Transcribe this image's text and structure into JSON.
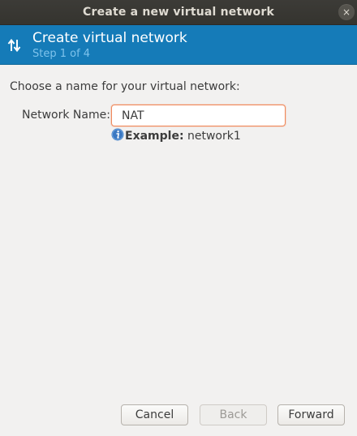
{
  "window": {
    "title": "Create a new virtual network",
    "close_glyph": "×"
  },
  "banner": {
    "icon": "network-arrows-icon",
    "title": "Create virtual network",
    "step": "Step 1 of 4"
  },
  "form": {
    "prompt": "Choose a name for your virtual network:",
    "name_label": "Network Name:",
    "name_value": "NAT",
    "hint_icon": "info-icon",
    "hint_label": "Example:",
    "hint_value": " network1"
  },
  "buttons": {
    "cancel": "Cancel",
    "back": "Back",
    "forward": "Forward"
  },
  "colors": {
    "banner_bg": "#157bb8",
    "input_focus_border": "#f08a5d",
    "info_icon": "#3b78c2"
  }
}
